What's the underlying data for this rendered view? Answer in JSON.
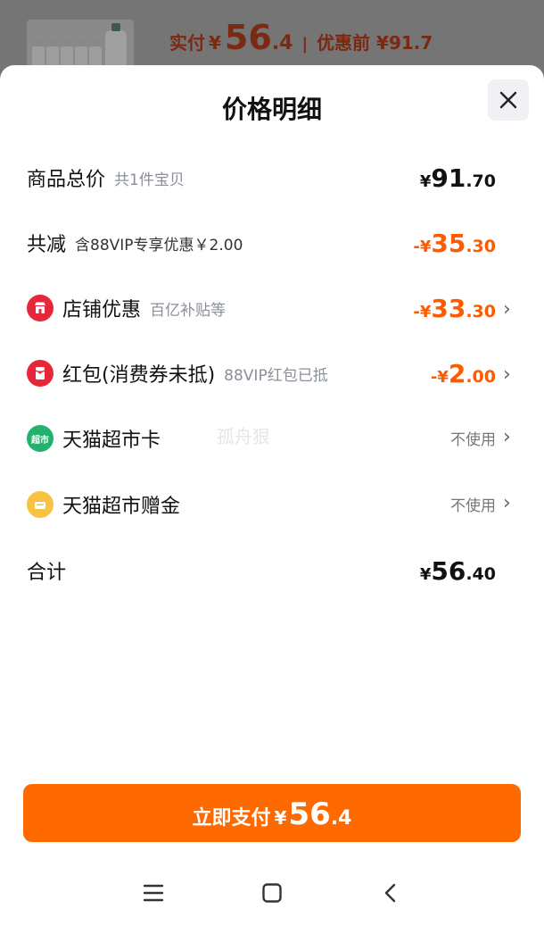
{
  "backdrop": {
    "paid_label": "实付",
    "paid_currency": "¥",
    "paid_int": "56",
    "paid_dec": ".4",
    "separator": "|",
    "before_discount": "优惠前 ¥91.7"
  },
  "sheet": {
    "title": "价格明细",
    "rows": {
      "total_goods": {
        "label": "商品总价",
        "sub": "共1件宝贝",
        "currency": "¥",
        "int": "91",
        "dec": ".70"
      },
      "total_reduction": {
        "label": "共减",
        "sub": "含88VIP专享优惠￥2.00",
        "currency": "-¥",
        "int": "35",
        "dec": ".30"
      },
      "store_discount": {
        "label": "店铺优惠",
        "sub": "百亿补贴等",
        "currency": "-¥",
        "int": "33",
        "dec": ".30"
      },
      "red_packet": {
        "label": "红包(消费券未抵)",
        "sub": "88VIP红包已抵",
        "currency": "-¥",
        "int": "2",
        "dec": ".00"
      },
      "tmall_card": {
        "label": "天猫超市卡",
        "status": "不使用",
        "icon_text": "超市"
      },
      "tmall_bonus": {
        "label": "天猫超市赠金",
        "status": "不使用"
      },
      "grand_total": {
        "label": "合计",
        "currency": "¥",
        "int": "56",
        "dec": ".40"
      }
    },
    "watermark": "孤舟狠"
  },
  "pay_button": {
    "label": "立即支付",
    "currency": "¥",
    "int": "56",
    "dec": ".4"
  },
  "colors": {
    "accent": "#ff6a00",
    "discount": "#ff5a00",
    "store_icon": "#e8263a",
    "red_packet_icon": "#e8263a",
    "card_icon": "#23b26d",
    "bonus_icon": "#f5c242"
  },
  "icons": [
    "close-icon",
    "store-icon",
    "red-packet-icon",
    "tmall-card-icon",
    "tmall-bonus-icon",
    "chevron-right-icon",
    "menu-icon",
    "home-icon",
    "back-icon"
  ]
}
